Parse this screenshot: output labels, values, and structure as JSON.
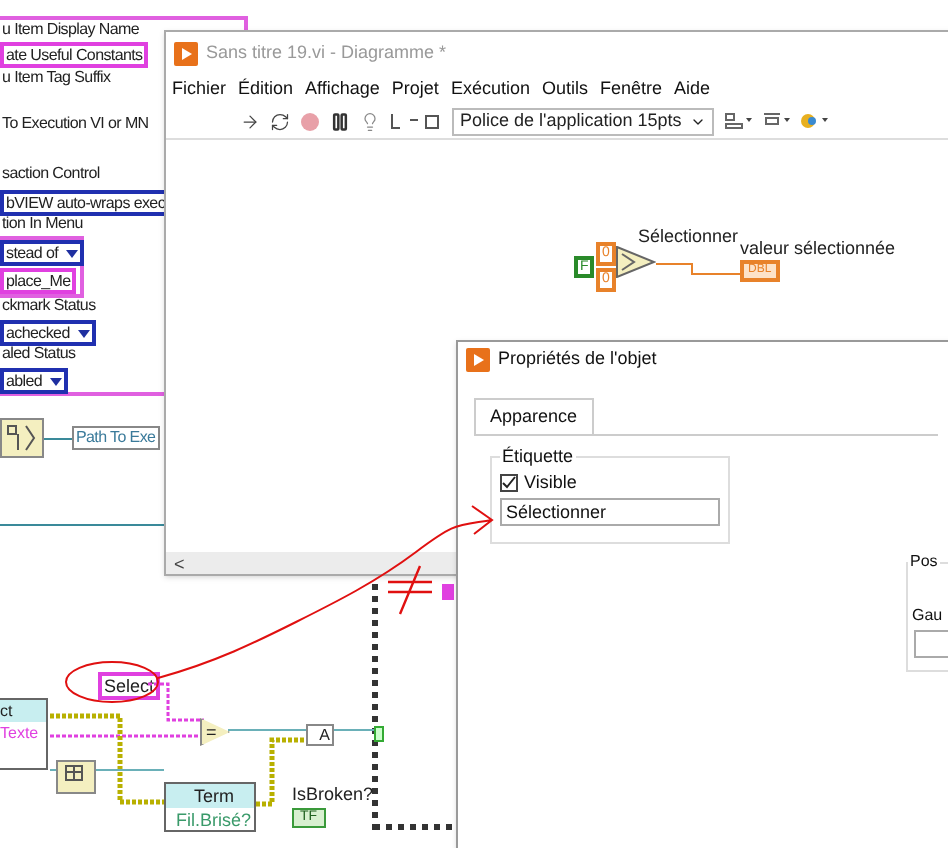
{
  "left_labels": [
    {
      "kind": "label",
      "text": "u Item Display Name"
    },
    {
      "kind": "constant",
      "text": "ate Useful Constants"
    },
    {
      "kind": "label",
      "text": "u Item Tag Suffix"
    },
    {
      "kind": "label",
      "text": "To Execution VI or MN"
    },
    {
      "kind": "label",
      "text": "saction Control"
    },
    {
      "kind": "path",
      "text": "bVIEW auto-wraps exec"
    },
    {
      "kind": "label",
      "text": "tion In Menu"
    },
    {
      "kind": "enum",
      "text": "stead of"
    },
    {
      "kind": "constant",
      "text": "place_Me"
    },
    {
      "kind": "label",
      "text": "ckmark Status"
    },
    {
      "kind": "enum",
      "text": "achecked"
    },
    {
      "kind": "label",
      "text": "aled Status"
    },
    {
      "kind": "enum",
      "text": "abled"
    }
  ],
  "path_constant": "Path To Exe",
  "diagram_window": {
    "title": "Sans titre 19.vi - Diagramme *",
    "menu": [
      "Fichier",
      "Édition",
      "Affichage",
      "Projet",
      "Exécution",
      "Outils",
      "Fenêtre",
      "Aide"
    ],
    "font_dropdown": "Police de l'application 15pts",
    "scroll_left": "<",
    "node": {
      "label": "Sélectionner",
      "selector": "F",
      "inputs": [
        "0",
        "0"
      ],
      "indicator_label": "valeur sélectionnée",
      "indicator": "DBL"
    }
  },
  "properties_dialog": {
    "title": "Propriétés de l'objet",
    "tabs": [
      {
        "label": "Apparence",
        "selected": true
      }
    ],
    "label_group": {
      "title": "Étiquette",
      "visible": {
        "label": "Visible",
        "checked": true
      },
      "value": "Sélectionner"
    },
    "position_group": {
      "title": "Pos",
      "field_label": "Gau"
    }
  },
  "bottom_diagram": {
    "select_constant": "Select",
    "node_rows": [
      "ct",
      "Texte"
    ],
    "equal": "=",
    "bundle": "A",
    "term_node": {
      "title": "Term",
      "property": "Fil.Brisé?"
    },
    "indicator_label": "IsBroken?",
    "indicator": "TF"
  }
}
